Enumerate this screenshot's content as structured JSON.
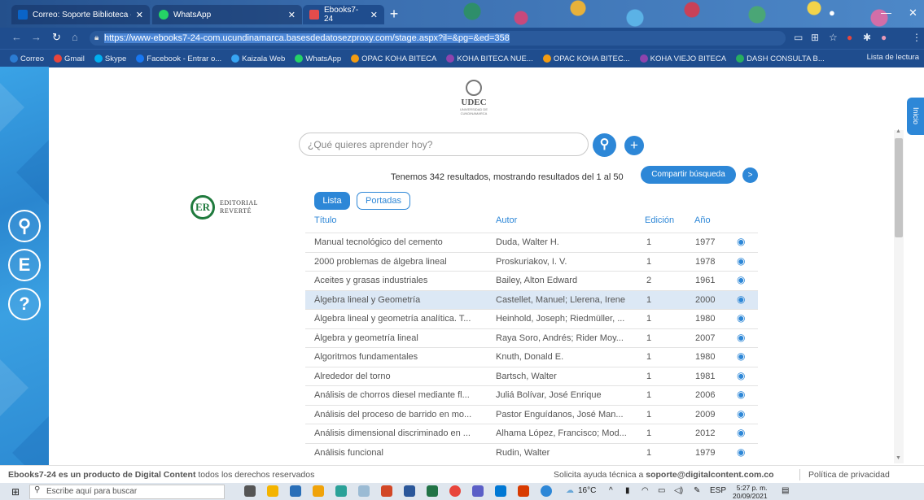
{
  "browser": {
    "tabs": [
      {
        "label": "Correo: Soporte Biblioteca - Outl",
        "fav_color": "#0a64c8"
      },
      {
        "label": "WhatsApp",
        "fav_color": "#25d366"
      },
      {
        "label": "Ebooks7-24",
        "fav_color": "#e54c4c"
      }
    ],
    "new_tab": "+",
    "url_base": "https://www-ebooks7-24-com.ucundinamarca.basesdedatosezproxy.com/stage.aspx?il=&pg=&ed=358",
    "bookmarks": [
      {
        "label": "Correo",
        "color": "#2b7cd3"
      },
      {
        "label": "Gmail",
        "color": "#e8453c"
      },
      {
        "label": "Skype",
        "color": "#00aff0"
      },
      {
        "label": "Facebook - Entrar o...",
        "color": "#1877f2"
      },
      {
        "label": "Kaizala Web",
        "color": "#37a5f3"
      },
      {
        "label": "WhatsApp",
        "color": "#25d366"
      },
      {
        "label": "OPAC KOHA BITECA",
        "color": "#f39c12"
      },
      {
        "label": "KOHA BITECA NUE...",
        "color": "#8e44ad"
      },
      {
        "label": "OPAC KOHA BITEC...",
        "color": "#f39c12"
      },
      {
        "label": "KOHA VIEJO BITECA",
        "color": "#8e44ad"
      },
      {
        "label": "DASH CONSULTA B...",
        "color": "#27ae60"
      }
    ],
    "reading_list": "Lista de lectura"
  },
  "page": {
    "logo": {
      "name": "UDEC",
      "sub": "UNIVERSIDAD DE CUNDINAMARCA"
    },
    "search": {
      "placeholder": "¿Qué quieres aprender hoy?"
    },
    "results_text": "Tenemos 342 resultados, mostrando resultados del 1 al 50",
    "share_button": "Compartir búsqueda",
    "next_button": ">",
    "editorial": {
      "mark": "ER",
      "line1": "EDITORIAL",
      "line2": "REVERTÉ"
    },
    "view_tabs": {
      "list": "Lista",
      "covers": "Portadas"
    },
    "columns": {
      "title": "Título",
      "author": "Autor",
      "edition": "Edición",
      "year": "Año"
    },
    "rows": [
      {
        "title": "Manual tecnológico del cemento",
        "author": "Duda, Walter H.",
        "edition": "1",
        "year": "1977"
      },
      {
        "title": "2000 problemas de álgebra lineal",
        "author": "Proskuriakov, I. V.",
        "edition": "1",
        "year": "1978"
      },
      {
        "title": "Aceites y grasas industriales",
        "author": "Bailey, Alton Edward",
        "edition": "2",
        "year": "1961"
      },
      {
        "title": "Álgebra lineal y Geometría",
        "author": "Castellet, Manuel; Llerena, Irene",
        "edition": "1",
        "year": "2000",
        "highlight": true
      },
      {
        "title": "Álgebra lineal y geometría analítica. T...",
        "author": "Heinhold, Joseph; Riedmüller, ...",
        "edition": "1",
        "year": "1980"
      },
      {
        "title": "Álgebra y geometría lineal",
        "author": "Raya Soro, Andrés; Rider Moy...",
        "edition": "1",
        "year": "2007"
      },
      {
        "title": "Algoritmos fundamentales",
        "author": "Knuth, Donald E.",
        "edition": "1",
        "year": "1980"
      },
      {
        "title": "Alrededor del torno",
        "author": "Bartsch, Walter",
        "edition": "1",
        "year": "1981"
      },
      {
        "title": "Análisis de chorros diesel mediante fl...",
        "author": "Juliá Bolívar, José Enrique",
        "edition": "1",
        "year": "2006"
      },
      {
        "title": "Análisis del proceso de barrido en mo...",
        "author": "Pastor Enguídanos, José Man...",
        "edition": "1",
        "year": "2009"
      },
      {
        "title": "Análisis dimensional discriminado en ...",
        "author": "Alhama López, Francisco; Mod...",
        "edition": "1",
        "year": "2012"
      },
      {
        "title": "Análisis funcional",
        "author": "Rudin, Walter",
        "edition": "1",
        "year": "1979"
      }
    ],
    "inicio": "Inicio"
  },
  "footer": {
    "brand": "Ebooks7-24 es un producto de Digital Content",
    "rights": " todos los derechos reservados",
    "help_prefix": "Solicita ayuda técnica a ",
    "help_email": "soporte@digitalcontent.com.co",
    "privacy": "Política de privacidad"
  },
  "taskbar": {
    "search_placeholder": "Escribe aquí para buscar",
    "temperature": "16°C",
    "language": "ESP",
    "time": "5:27 p. m.",
    "date": "20/09/2021"
  },
  "colors": {
    "accent": "#2d87d7",
    "sidebar": "#2a86cf",
    "browser": "#1f4d8e"
  }
}
